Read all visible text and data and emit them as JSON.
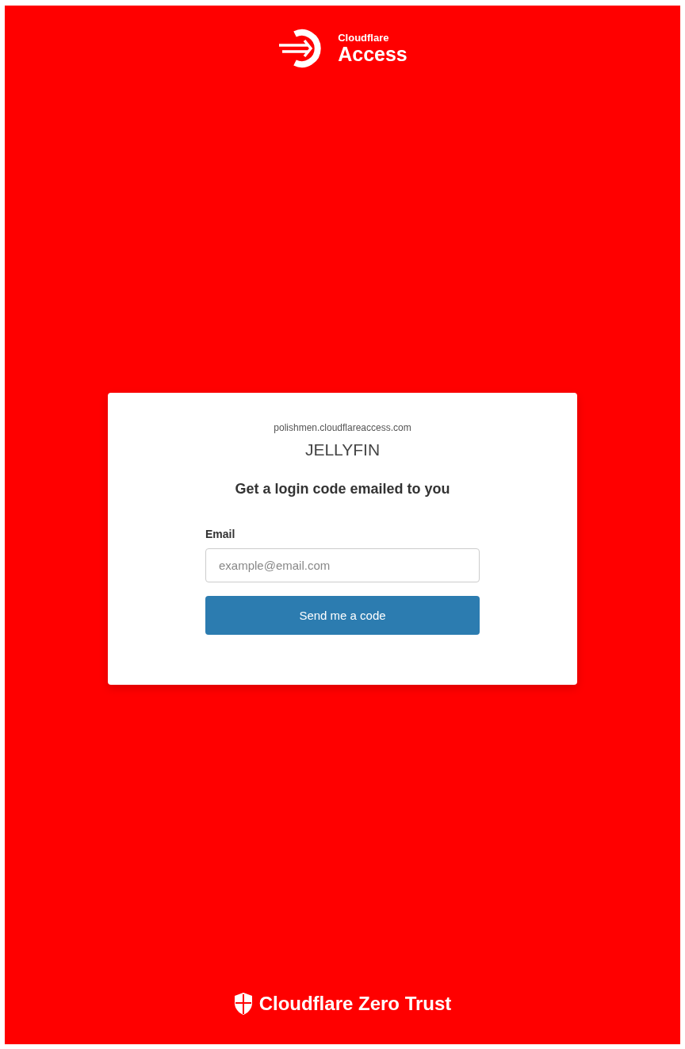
{
  "logo": {
    "brand": "Cloudflare",
    "product": "Access"
  },
  "card": {
    "domain": "polishmen.cloudflareaccess.com",
    "app_name": "JELLYFIN",
    "heading": "Get a login code emailed to you",
    "email_label": "Email",
    "email_placeholder": "example@email.com",
    "button": "Send me a code"
  },
  "footer": {
    "brand": "Cloudflare Zero Trust"
  }
}
